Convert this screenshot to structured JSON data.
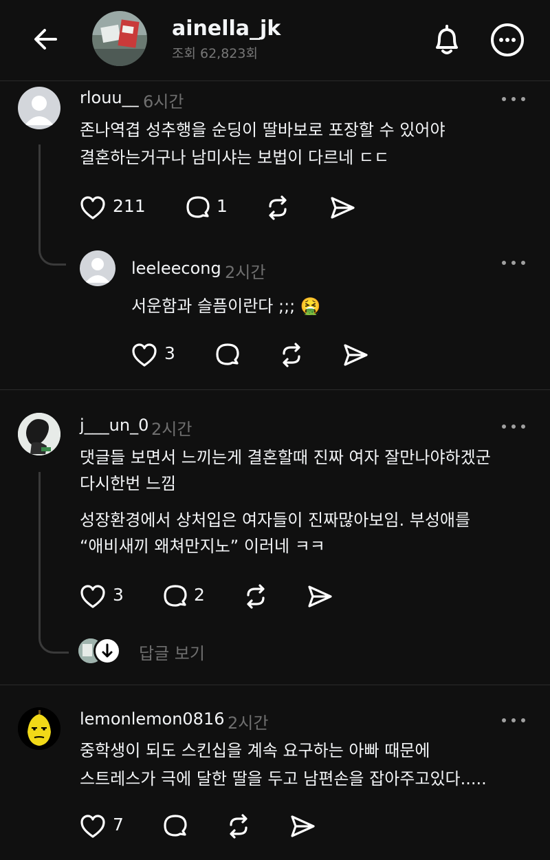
{
  "header": {
    "username": "ainella_jk",
    "views": "조회 62,823회",
    "icons": {
      "back": "arrow-left-icon",
      "bell": "bell-icon",
      "more": "more-circle-icon"
    }
  },
  "comments": [
    {
      "username": "rlouu__",
      "time": "6시간",
      "lines": [
        "존나역겹 성추행을 순딩이 딸바보로 포장할 수 있어야",
        "결혼하는거구나 남미샤는 보법이 다르네 ㄷㄷ"
      ],
      "likes": "211",
      "replies": "1",
      "reply": {
        "username": "leeleecong",
        "time": "2시간",
        "text": "서운함과 슬픔이란다 ;;; 🤮",
        "likes": "3"
      }
    },
    {
      "username": "j___un_0",
      "time": "2시간",
      "lines": [
        "댓글들 보면서 느끼는게 결혼할때 진짜 여자 잘만나야하겠군",
        "다시한번 느낌"
      ],
      "lines2": [
        "성장환경에서 상처입은 여자들이 진짜많아보임. 부성애를",
        "“애비새끼 왜쳐만지노” 이러네 ㅋㅋ"
      ],
      "likes": "3",
      "replies": "2",
      "see_replies": "답글 보기"
    },
    {
      "username": "lemonlemon0816",
      "time": "2시간",
      "lines": [
        "중학생이 되도 스킨십을 계속 요구하는 아빠 때문에",
        "스트레스가 극에 달한 딸을 두고 남편손을 잡아주고있다....."
      ],
      "likes": "7"
    }
  ],
  "colors": {
    "background": "#101010",
    "text": "#f3f5f7",
    "muted": "#6f6f6f",
    "line": "#3a3a3a"
  }
}
